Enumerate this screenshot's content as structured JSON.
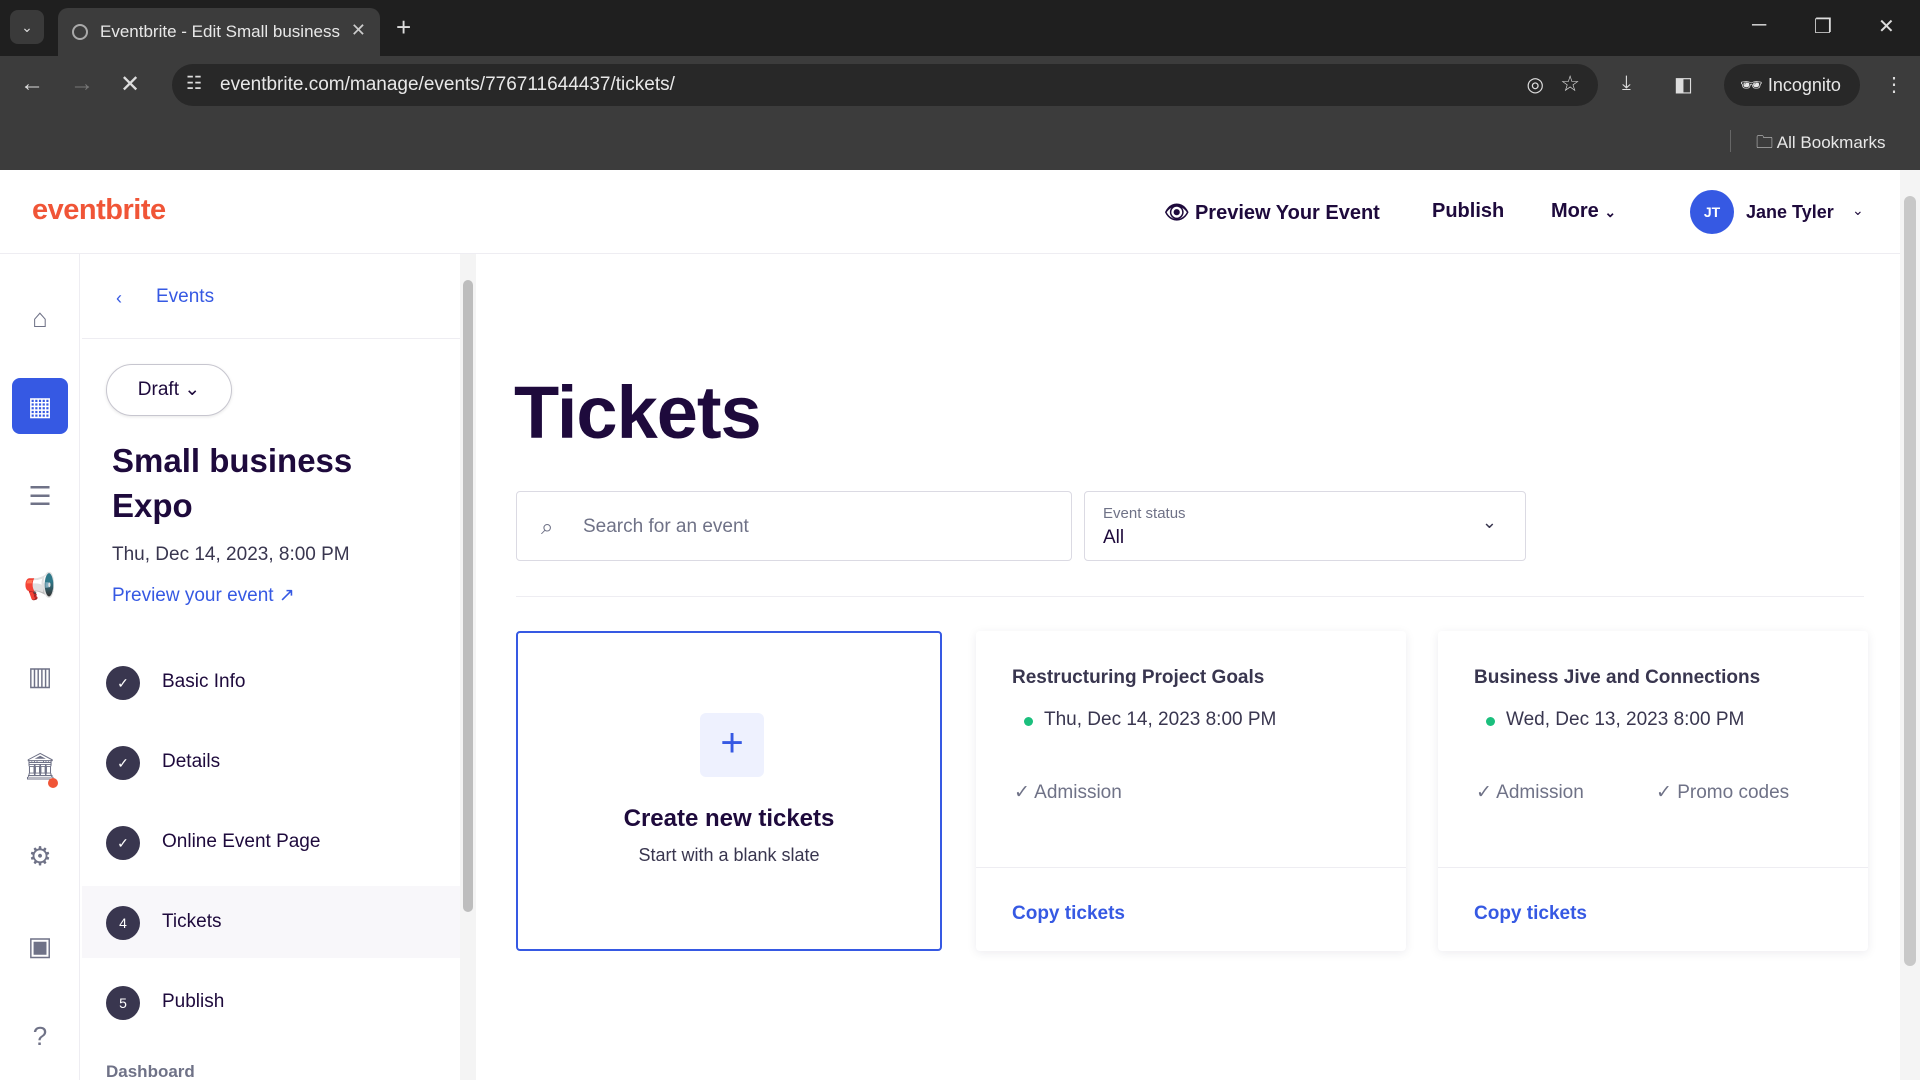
{
  "browser": {
    "tab_title": "Eventbrite - Edit Small business",
    "url": "eventbrite.com/manage/events/776711644437/tickets/",
    "incognito_label": "Incognito",
    "bookmarks_label": "All Bookmarks"
  },
  "header": {
    "logo": "eventbrite",
    "preview_label": "Preview Your Event",
    "publish_label": "Publish",
    "more_label": "More",
    "avatar_initials": "JT",
    "user_name": "Jane Tyler"
  },
  "sidebar": {
    "back_label": "Events",
    "status_button": "Draft",
    "event_name": "Small business Expo",
    "event_date": "Thu, Dec 14, 2023, 8:00 PM",
    "preview_link": "Preview your event",
    "steps": [
      {
        "marker": "✓",
        "label": "Basic Info"
      },
      {
        "marker": "✓",
        "label": "Details"
      },
      {
        "marker": "✓",
        "label": "Online Event Page"
      },
      {
        "marker": "4",
        "label": "Tickets"
      },
      {
        "marker": "5",
        "label": "Publish"
      }
    ],
    "section_cut_label": "Dashboard"
  },
  "main": {
    "title": "Tickets",
    "search_placeholder": "Search for an event",
    "status_filter": {
      "label": "Event status",
      "value": "All"
    },
    "create_card": {
      "title": "Create new tickets",
      "subtitle": "Start with a blank slate"
    },
    "events": [
      {
        "title": "Restructuring Project Goals",
        "date": "Thu, Dec 14, 2023 8:00 PM",
        "items": [
          "Admission"
        ],
        "copy_label": "Copy tickets"
      },
      {
        "title": "Business Jive and Connections",
        "date": "Wed, Dec 13, 2023 8:00 PM",
        "items": [
          "Admission",
          "Promo codes"
        ],
        "copy_label": "Copy tickets"
      }
    ]
  },
  "colors": {
    "brand": "#f05537",
    "accent": "#3659e3",
    "text": "#1e0a3c",
    "status_dot": "#1bbf7d"
  }
}
